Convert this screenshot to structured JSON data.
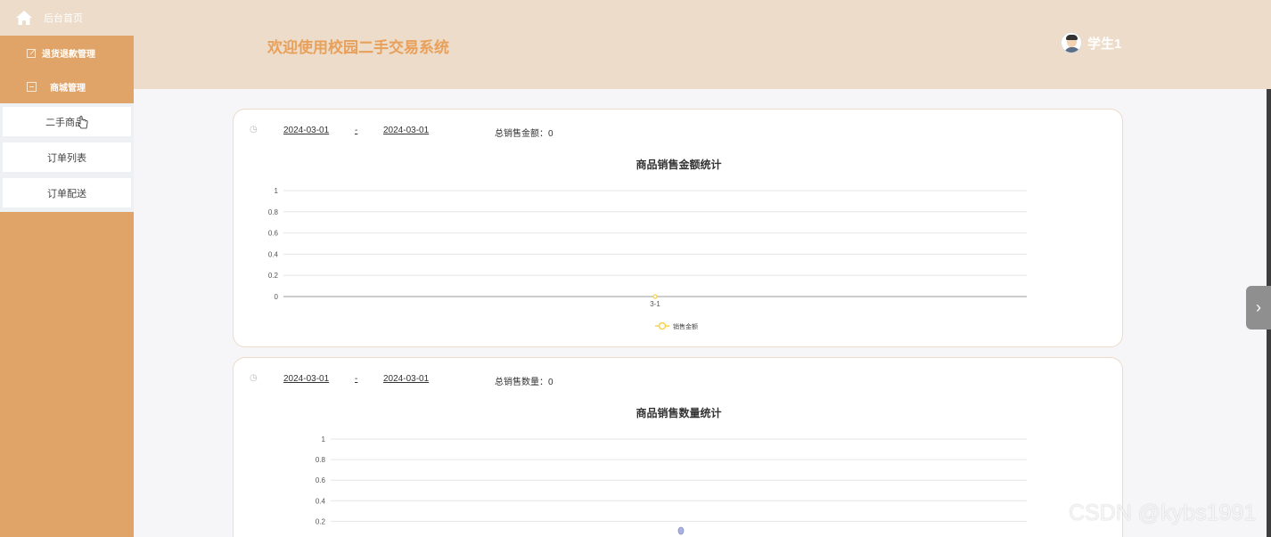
{
  "sidebar": {
    "home": {
      "label": "后台首页"
    },
    "groups": [
      {
        "label": "退货退款管理"
      },
      {
        "label": "商城管理"
      }
    ],
    "sub_items": [
      {
        "label": "二手商品"
      },
      {
        "label": "订单列表"
      },
      {
        "label": "订单配送"
      }
    ]
  },
  "header": {
    "title": "欢迎使用校园二手交易系统",
    "user_name": "学生1"
  },
  "card1": {
    "start_date": "2024-03-01",
    "separator": "-",
    "end_date": "2024-03-01",
    "total_label": "总销售金额：0"
  },
  "card2": {
    "start_date": "2024-03-01",
    "separator": "-",
    "end_date": "2024-03-01",
    "total_label": "总销售数量：0"
  },
  "chart_data": [
    {
      "type": "line",
      "title": "商品销售金额统计",
      "categories": [
        "3-1"
      ],
      "series": [
        {
          "name": "销售金额",
          "values": [
            0
          ]
        }
      ],
      "y_ticks": [
        "1",
        "0.8",
        "0.6",
        "0.4",
        "0.2",
        "0"
      ],
      "ylim": [
        0,
        1
      ],
      "grid": true,
      "legend": "bottom-center",
      "color": "#f5d24b"
    },
    {
      "type": "bar",
      "title": "商品销售数量统计",
      "categories": [],
      "series": [],
      "y_ticks": [
        "1",
        "0.8",
        "0.6",
        "0.4",
        "0.2"
      ],
      "ylim": [
        0,
        1
      ],
      "grid": true,
      "color": "#a9b3e0"
    }
  ],
  "watermark": "CSDN @kybs1991",
  "colors": {
    "sidebar": "#e0a469",
    "header": "#ecdcc9",
    "title": "#e8a05a"
  }
}
